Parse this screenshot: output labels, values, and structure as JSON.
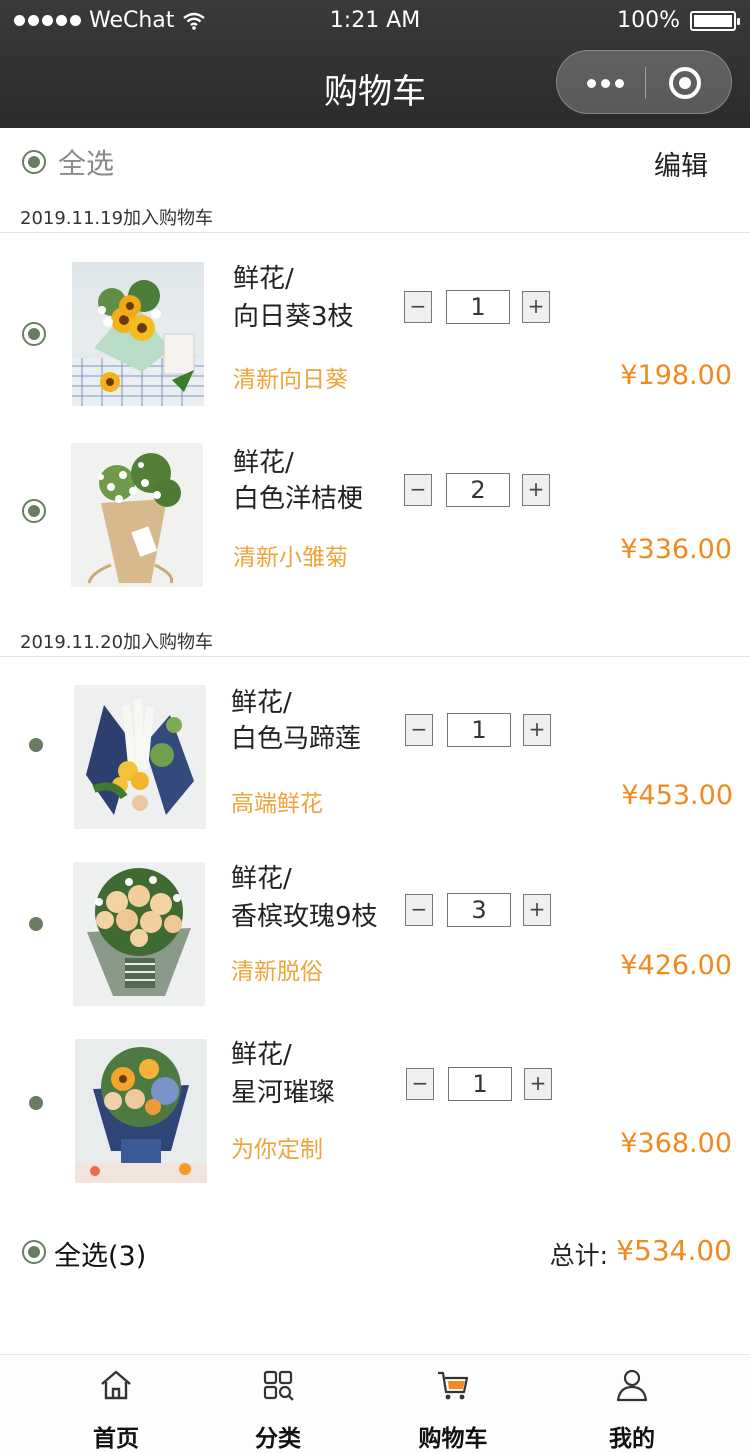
{
  "status_bar": {
    "carrier": "WeChat",
    "time": "1:21 AM",
    "battery": "100%"
  },
  "nav": {
    "title": "购物车"
  },
  "top": {
    "select_all": "全选",
    "edit": "编辑"
  },
  "groups": [
    {
      "date": "2019.11.19加入购物车",
      "items": [
        {
          "category": "鲜花/",
          "name": "向日葵3枝",
          "quantity": "1",
          "tag": "清新向日葵",
          "price": "¥198.00",
          "selected": true
        },
        {
          "category": "鲜花/",
          "name": "白色洋桔梗",
          "quantity": "2",
          "tag": "清新小雏菊",
          "price": "¥336.00",
          "selected": true
        }
      ]
    },
    {
      "date": "2019.11.20加入购物车",
      "items": [
        {
          "category": "鲜花/",
          "name": "白色马蹄莲",
          "quantity": "1",
          "tag": "高端鲜花",
          "price": "¥453.00",
          "selected": false
        },
        {
          "category": "鲜花/",
          "name": "香槟玫瑰9枝",
          "quantity": "3",
          "tag": "清新脱俗",
          "price": "¥426.00",
          "selected": false
        },
        {
          "category": "鲜花/",
          "name": "星河璀璨",
          "quantity": "1",
          "tag": "为你定制",
          "price": "¥368.00",
          "selected": false
        }
      ]
    }
  ],
  "qty_controls": {
    "minus": "−",
    "plus": "+"
  },
  "footer": {
    "select_all": "全选(3)",
    "total_label": "总计:",
    "total": "¥534.00"
  },
  "tabs": [
    {
      "label": "首页",
      "icon": "home-icon"
    },
    {
      "label": "分类",
      "icon": "category-icon"
    },
    {
      "label": "购物车",
      "icon": "cart-icon"
    },
    {
      "label": "我的",
      "icon": "user-icon"
    }
  ],
  "colors": {
    "accent": "#f08a1e",
    "tag": "#f0a43a",
    "radio": "#6a7d62",
    "header": "#2f2f31"
  }
}
